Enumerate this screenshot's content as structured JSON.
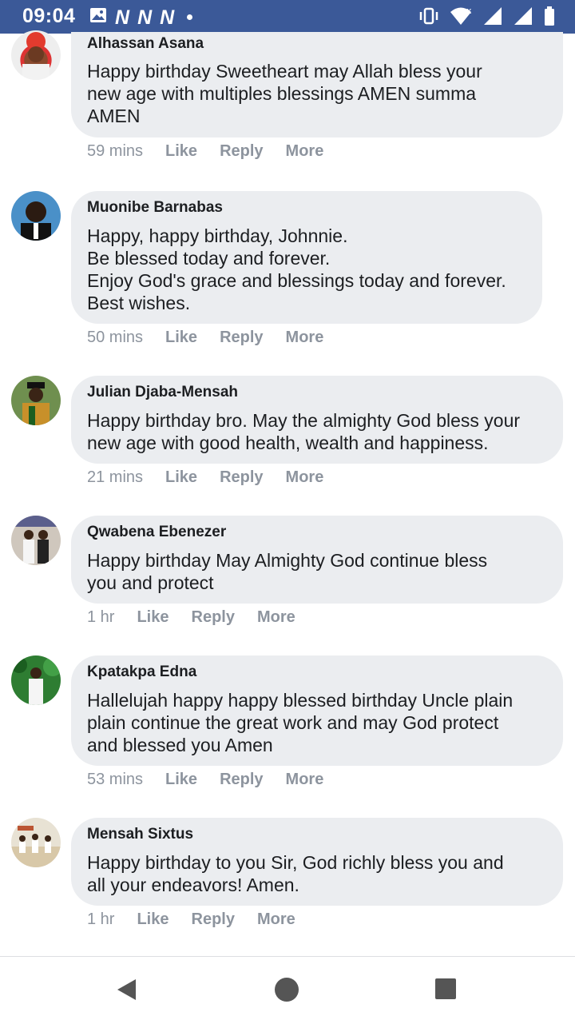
{
  "status_bar": {
    "time": "09:04",
    "left_icons": [
      "image-icon",
      "n-icon",
      "n-icon",
      "n-icon",
      "dot-icon"
    ],
    "n_glyph": "N",
    "right_icons": [
      "vibrate-icon",
      "wifi-icon",
      "signal-icon",
      "signal-icon",
      "battery-icon"
    ],
    "background": "#3b5998"
  },
  "comments": [
    {
      "author": "Alhassan Asana",
      "text": "Happy birthday Sweetheart may Allah bless your\nnew age with multiples blessings AMEN summa\nAMEN",
      "time": "59 mins",
      "like": "Like",
      "reply": "Reply",
      "more": "More"
    },
    {
      "author": "Muonibe Barnabas",
      "text": "Happy, happy birthday, Johnnie.\nBe blessed today and forever.\nEnjoy God's grace and blessings today and forever.\nBest wishes.",
      "time": "50 mins",
      "like": "Like",
      "reply": "Reply",
      "more": "More"
    },
    {
      "author": "Julian Djaba-Mensah",
      "text": "Happy birthday bro. May the almighty God bless your\nnew age with good health, wealth and happiness.",
      "time": "21 mins",
      "like": "Like",
      "reply": "Reply",
      "more": "More"
    },
    {
      "author": "Qwabena Ebenezer",
      "text": "Happy birthday May Almighty God continue bless\nyou and protect",
      "time": "1 hr",
      "like": "Like",
      "reply": "Reply",
      "more": "More"
    },
    {
      "author": "Kpatakpa Edna",
      "text": "Hallelujah happy happy blessed birthday Uncle plain\nplain continue the great work and may God protect\nand blessed you Amen",
      "time": "53 mins",
      "like": "Like",
      "reply": "Reply",
      "more": "More"
    },
    {
      "author": "Mensah Sixtus",
      "text": "Happy birthday to you Sir, God richly bless you and\nall your endeavors! Amen.",
      "time": "1 hr",
      "like": "Like",
      "reply": "Reply",
      "more": "More"
    }
  ],
  "nav_bar": {
    "buttons": [
      "back-icon",
      "home-icon",
      "recents-icon"
    ]
  }
}
